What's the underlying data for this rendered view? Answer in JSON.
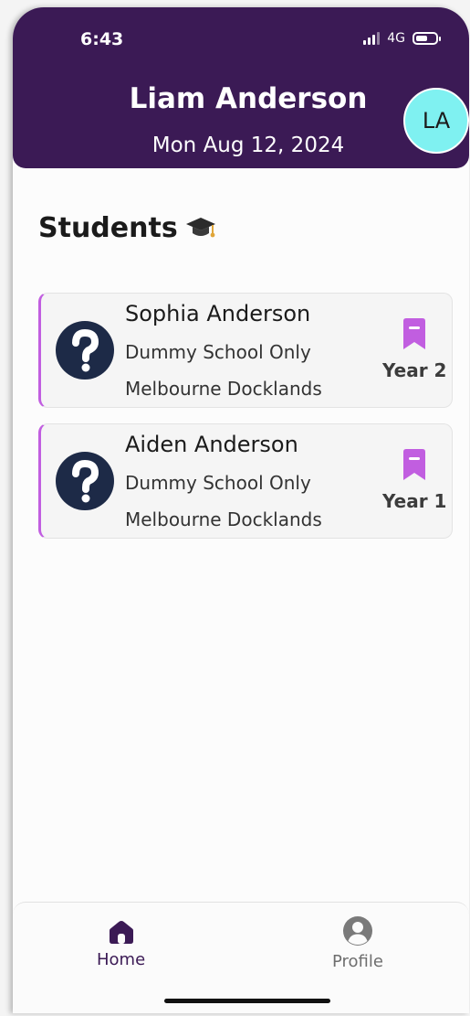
{
  "status_bar": {
    "time": "6:43",
    "network": "4G",
    "battery_level": 0.6
  },
  "header": {
    "user_name": "Liam Anderson",
    "date": "Mon Aug 12, 2024",
    "avatar_initials": "LA",
    "background_color": "#3b1a55",
    "avatar_color": "#7ff1f1"
  },
  "students_section": {
    "title": "Students",
    "title_icon": "graduation-cap-icon",
    "accent_color": "#c15ee0",
    "students": [
      {
        "name": "Sophia Anderson",
        "school": "Dummy School Only",
        "campus": "Melbourne Docklands",
        "year": "Year 2",
        "photo_icon": "question-mark-icon",
        "tag_icon": "bookmark-icon"
      },
      {
        "name": "Aiden Anderson",
        "school": "Dummy School Only",
        "campus": "Melbourne Docklands",
        "year": "Year 1",
        "photo_icon": "question-mark-icon",
        "tag_icon": "bookmark-icon"
      }
    ]
  },
  "bottom_nav": {
    "items": [
      {
        "label": "Home",
        "icon": "home-icon",
        "active": true
      },
      {
        "label": "Profile",
        "icon": "profile-icon",
        "active": false
      }
    ]
  }
}
